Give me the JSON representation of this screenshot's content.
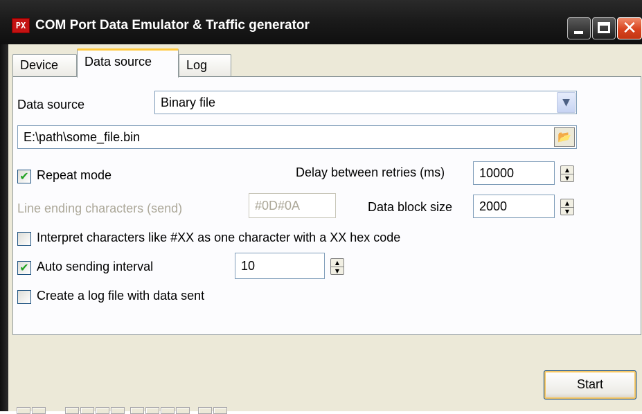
{
  "window": {
    "title": "COM Port Data Emulator & Traffic generator",
    "icon_text": "PX",
    "close_glyph": "✕"
  },
  "tabs": [
    {
      "label": "Device",
      "active": false
    },
    {
      "label": "Data source",
      "active": true
    },
    {
      "label": "Log",
      "active": false
    }
  ],
  "form": {
    "data_source_label": "Data source",
    "data_source_value": "Binary file",
    "file_path": "E:\\path\\some_file.bin",
    "repeat_mode": {
      "label": "Repeat mode",
      "checked": true
    },
    "delay_label": "Delay between retries (ms)",
    "delay_value": "10000",
    "line_ending_label": "Line ending characters (send)",
    "line_ending_value": "#0D#0A",
    "block_size_label": "Data block size",
    "block_size_value": "2000",
    "interpret": {
      "label": "Interpret characters like #XX as one character with a XX hex code",
      "checked": false
    },
    "auto_send": {
      "label": "Auto sending interval",
      "checked": true
    },
    "auto_send_value": "10",
    "create_log": {
      "label": "Create a log file with data sent",
      "checked": false
    }
  },
  "buttons": {
    "start": "Start"
  },
  "glyphs": {
    "checkmark": "✔",
    "dropdown_arrow": "▼",
    "folder_icon": "📂",
    "spin_up": "▲",
    "spin_down": "▼"
  },
  "colors": {
    "titlebar": "#1b1b1b",
    "client_bg": "#ece9d8",
    "panel_bg": "#fcfcfe",
    "active_tab_accent": "#ffc83c",
    "checkmark": "#21a121",
    "close_button": "#d8431f"
  }
}
